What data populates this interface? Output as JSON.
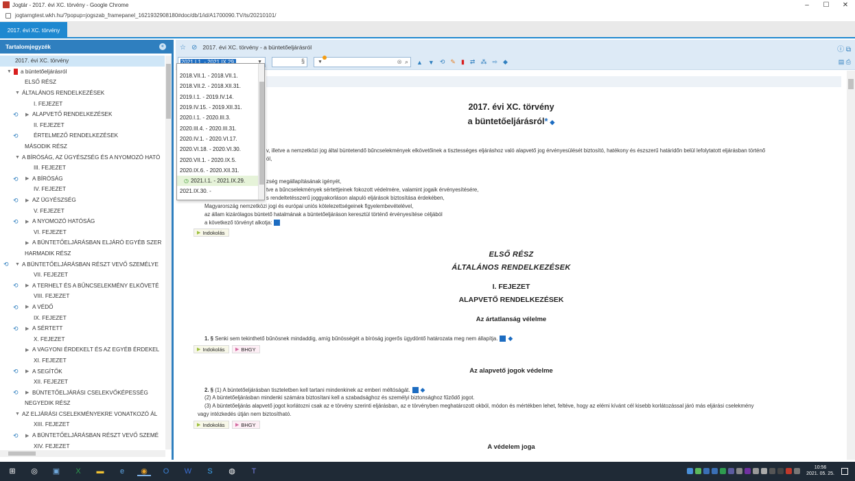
{
  "window": {
    "title": "Jogtár - 2017. évi XC. törvény - Google Chrome",
    "url": "jogtarngtest.wkh.hu/?popup=jogszab_framepanel_1621932908180#doc/db/1/id/A1700090.TV/ts/20210101/",
    "minimize": "–",
    "maximize": "☐",
    "close": "✕"
  },
  "tab": {
    "label": "2017. évi XC. törvény"
  },
  "sidebar": {
    "title": "Tartalomjegyzék",
    "collapse_icon": "«",
    "items": [
      "2017. évi XC. törvény",
      "a büntetőeljárásról",
      "ELSŐ RÉSZ",
      "ÁLTALÁNOS RENDELKEZÉSEK",
      "I. FEJEZET",
      "ALAPVETŐ RENDELKEZÉSEK",
      "II. FEJEZET",
      "ÉRTELMEZŐ RENDELKEZÉSEK",
      "MÁSODIK RÉSZ",
      "A BÍRÓSÁG, AZ ÜGYÉSZSÉG ÉS A NYOMOZÓ HATÓ",
      "III. FEJEZET",
      "A BÍRÓSÁG",
      "IV. FEJEZET",
      "AZ ÜGYÉSZSÉG",
      "V. FEJEZET",
      "A NYOMOZÓ HATÓSÁG",
      "VI. FEJEZET",
      "A BÜNTETŐELJÁRÁSBAN ELJÁRÓ EGYÉB SZER",
      "HARMADIK RÉSZ",
      "A BÜNTETŐELJÁRÁSBAN RÉSZT VEVŐ SZEMÉLYE",
      "VII. FEJEZET",
      "A TERHELT ÉS A BŰNCSELEKMÉNY ELKÖVETÉ",
      "VIII. FEJEZET",
      "A VÉDŐ",
      "IX. FEJEZET",
      "A SÉRTETT",
      "X. FEJEZET",
      "A VAGYONI ÉRDEKELT ÉS AZ EGYÉB ÉRDEKEL",
      "XI. FEJEZET",
      "A SEGÍTŐK",
      "XII. FEJEZET",
      "BÜNTETŐELJÁRÁSI CSELEKVŐKÉPESSÉG",
      "NEGYEDIK RÉSZ",
      "AZ ELJÁRÁSI CSELEKMÉNYEKRE VONATKOZÓ ÁL",
      "XIII. FEJEZET",
      "A BÜNTETŐELJÁRÁSBAN RÉSZT VEVŐ SZEMÉ",
      "XIV. FEJEZET"
    ]
  },
  "main": {
    "header_title": "2017. évi XC. törvény - a büntetőeljárásról",
    "date_selected": "2021.I.1. - 2021.IX.29.",
    "para_symbol": "§",
    "date_options": [
      "2018.VII.1. - 2018.VII.1.",
      "2018.VII.2. - 2018.XII.31.",
      "2019.I.1. - 2019.IV.14.",
      "2019.IV.15. - 2019.XII.31.",
      "2020.I.1. - 2020.III.3.",
      "2020.III.4. - 2020.III.31.",
      "2020.IV.1. - 2020.VI.17.",
      "2020.VI.18. - 2020.VI.30.",
      "2020.VII.1. - 2020.IX.5.",
      "2020.IX.6. - 2020.XII.31.",
      "2021.I.1. - 2021.IX.29.",
      "2021.IX.30. -"
    ]
  },
  "document": {
    "title1": "2017. évi XC. törvény",
    "title2": "a büntetőeljárásról",
    "title_star": "*",
    "intro_lines": [
      "v, illetve a nemzetközi jog által büntetendő bűncselekmények elkövetőinek a tisztességes eljáráshoz való alapvető jog érvényesülését biztosító, hatékony és észszerű határidőn belül lefolytatott eljárásban történő",
      "ól,",
      "zség megállapításának igényét,",
      "tve a bűncselekmények sértettjeinek fokozott védelmére, valamint jogaik érvényesítésére,",
      "s rendeltetésszerű joggyakorláson alapuló eljárások biztosítása érdekében,",
      "Magyarország nemzetközi jogi és európai uniós kötelezettségeinek figyelembevételével,",
      "az állam kizárólagos büntető hatalmának a büntetőeljáráson keresztül történő érvényesítése céljából",
      "a következő törvényt alkotja:"
    ],
    "tag_indokolas": "Indokolás",
    "tag_bhgy": "BHGY",
    "part1": "ELSŐ RÉSZ",
    "part1_sub": "ÁLTALÁNOS RENDELKEZÉSEK",
    "chapter1": "I. FEJEZET",
    "chapter1_sub": "ALAPVETŐ RENDELKEZÉSEK",
    "sec1_title": "Az ártatlanság vélelme",
    "sec1_num": "1. §",
    "sec1_text": "Senki sem tekinthető bűnösnek mindaddig, amíg bűnösségét a bíróság jogerős ügydöntő határozata meg nem állapítja.",
    "sec2_title": "Az alapvető jogok védelme",
    "sec2_num": "2. §",
    "sec2_p1": "(1) A büntetőeljárásban tiszteletben kell tartani mindenkinek az emberi méltóságát.",
    "sec2_p2": "(2) A büntetőeljárásban mindenki számára biztosítani kell a szabadsághoz és személyi biztonsághoz fűződő jogot.",
    "sec2_p3a": "(3) A büntetőeljárás alapvető jogot korlátozni csak az e törvény szerinti eljárásban, az e törvényben meghatározott okból, módon és mértékben lehet, feltéve, hogy az elérni kívánt cél kisebb korlátozással járó más eljárási cselekmény",
    "sec2_p3b": "vagy intézkedés útján nem biztosítható.",
    "sec3_title": "A védelem joga"
  },
  "taskbar": {
    "time": "10:56",
    "date": "2021. 05. 25."
  },
  "colors": {
    "accent": "#2f7fbf",
    "tab": "#1e88d0"
  }
}
